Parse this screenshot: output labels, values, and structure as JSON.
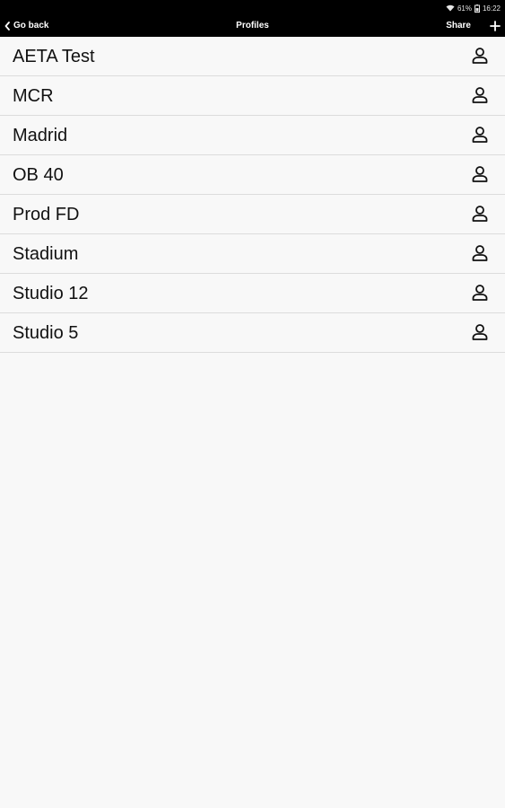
{
  "status_bar": {
    "battery": "61%",
    "time": "16:22",
    "icons": [
      "wifi-icon",
      "battery-icon"
    ]
  },
  "nav": {
    "back_label": "Go back",
    "title": "Profiles",
    "share_label": "Share",
    "icons": [
      "chevron-left-icon",
      "plus-icon"
    ]
  },
  "profiles": [
    {
      "label": "AETA Test",
      "icon": "person-icon"
    },
    {
      "label": "MCR",
      "icon": "person-icon"
    },
    {
      "label": "Madrid",
      "icon": "person-icon"
    },
    {
      "label": "OB 40",
      "icon": "person-icon"
    },
    {
      "label": "Prod FD",
      "icon": "person-icon"
    },
    {
      "label": "Stadium",
      "icon": "person-icon"
    },
    {
      "label": "Studio 12",
      "icon": "person-icon"
    },
    {
      "label": "Studio 5",
      "icon": "person-icon"
    }
  ],
  "colors": {
    "header_bg": "#000000",
    "header_text": "#ffffff",
    "list_bg": "#f8f8f8",
    "divider": "#dcdcdc",
    "text": "#111111"
  }
}
